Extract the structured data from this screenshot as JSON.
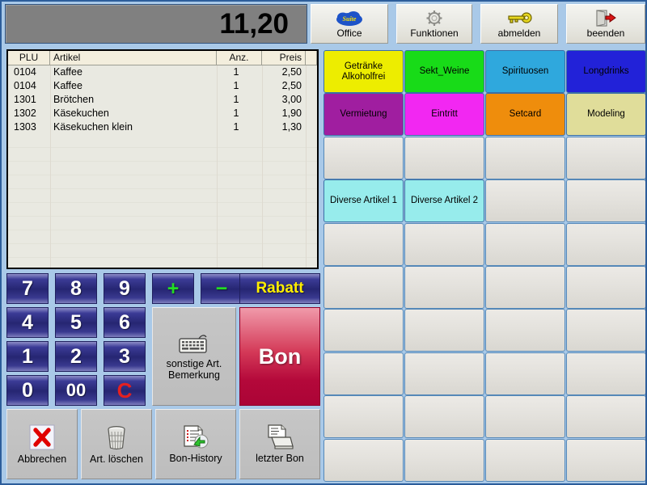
{
  "total": {
    "value": "11,20"
  },
  "toolbar": [
    {
      "label": "Office",
      "icon": "suite-cloud-icon"
    },
    {
      "label": "Funktionen",
      "icon": "gear-icon"
    },
    {
      "label": "abmelden",
      "icon": "key-icon"
    },
    {
      "label": "beenden",
      "icon": "exit-door-icon"
    }
  ],
  "receipt": {
    "columns": [
      "PLU",
      "Artikel",
      "Anz.",
      "Preis"
    ],
    "rows": [
      {
        "plu": "0104",
        "artikel": "Kaffee",
        "anz": "1",
        "preis": "2,50"
      },
      {
        "plu": "0104",
        "artikel": "Kaffee",
        "anz": "1",
        "preis": "2,50"
      },
      {
        "plu": "1301",
        "artikel": "Brötchen",
        "anz": "1",
        "preis": "3,00"
      },
      {
        "plu": "1302",
        "artikel": "Käsekuchen",
        "anz": "1",
        "preis": "1,90"
      },
      {
        "plu": "1303",
        "artikel": "Käsekuchen klein",
        "anz": "1",
        "preis": "1,30"
      }
    ]
  },
  "keypad": {
    "keys": [
      "7",
      "8",
      "9",
      "4",
      "5",
      "6",
      "1",
      "2",
      "3",
      "0",
      "00"
    ],
    "clear_label": "C",
    "plus_label": "+",
    "minus_label": "−",
    "rabatt_label": "Rabatt",
    "bon_label": "Bon",
    "sonstige": {
      "line1": "sonstige Art.",
      "line2": "Bemerkung",
      "icon": "keyboard-icon"
    },
    "abbrechen": {
      "label": "Abbrechen",
      "icon": "red-x-icon"
    },
    "art_loeschen": {
      "label": "Art. löschen",
      "icon": "trash-icon"
    },
    "bon_history": {
      "label": "Bon-History",
      "icon": "document-history-icon"
    },
    "letzter_bon": {
      "label": "letzter Bon",
      "icon": "printer-icon"
    }
  },
  "grid": {
    "buttons": [
      {
        "label": "Getränke\nAlkoholfrei",
        "color": "#eded00",
        "text": "#000000"
      },
      {
        "label": "Sekt_Weine",
        "color": "#18db18",
        "text": "#000000"
      },
      {
        "label": "Spirituosen",
        "color": "#2fa8dd",
        "text": "#000000"
      },
      {
        "label": "Longdrinks",
        "color": "#2222d8",
        "text": "#000000"
      },
      {
        "label": "Vermietung",
        "color": "#a01ea0",
        "text": "#000000"
      },
      {
        "label": "Eintritt",
        "color": "#f227f2",
        "text": "#000000"
      },
      {
        "label": "Setcard",
        "color": "#ef8d0c",
        "text": "#000000"
      },
      {
        "label": "Modeling",
        "color": "#e0dd9a",
        "text": "#000000"
      },
      {
        "label": "",
        "color": "",
        "text": ""
      },
      {
        "label": "",
        "color": "",
        "text": ""
      },
      {
        "label": "",
        "color": "",
        "text": ""
      },
      {
        "label": "",
        "color": "",
        "text": ""
      },
      {
        "label": "Diverse Artikel 1",
        "color": "#97ecec",
        "text": "#000000"
      },
      {
        "label": "Diverse Artikel 2",
        "color": "#97ecec",
        "text": "#000000"
      },
      {
        "label": "",
        "color": "",
        "text": ""
      },
      {
        "label": "",
        "color": "",
        "text": ""
      },
      {
        "label": "",
        "color": "",
        "text": ""
      },
      {
        "label": "",
        "color": "",
        "text": ""
      },
      {
        "label": "",
        "color": "",
        "text": ""
      },
      {
        "label": "",
        "color": "",
        "text": ""
      },
      {
        "label": "",
        "color": "",
        "text": ""
      },
      {
        "label": "",
        "color": "",
        "text": ""
      },
      {
        "label": "",
        "color": "",
        "text": ""
      },
      {
        "label": "",
        "color": "",
        "text": ""
      },
      {
        "label": "",
        "color": "",
        "text": ""
      },
      {
        "label": "",
        "color": "",
        "text": ""
      },
      {
        "label": "",
        "color": "",
        "text": ""
      },
      {
        "label": "",
        "color": "",
        "text": ""
      },
      {
        "label": "",
        "color": "",
        "text": ""
      },
      {
        "label": "",
        "color": "",
        "text": ""
      },
      {
        "label": "",
        "color": "",
        "text": ""
      },
      {
        "label": "",
        "color": "",
        "text": ""
      },
      {
        "label": "",
        "color": "",
        "text": ""
      },
      {
        "label": "",
        "color": "",
        "text": ""
      },
      {
        "label": "",
        "color": "",
        "text": ""
      },
      {
        "label": "",
        "color": "",
        "text": ""
      },
      {
        "label": "",
        "color": "",
        "text": ""
      },
      {
        "label": "",
        "color": "",
        "text": ""
      },
      {
        "label": "",
        "color": "",
        "text": ""
      },
      {
        "label": "",
        "color": "",
        "text": ""
      }
    ]
  }
}
